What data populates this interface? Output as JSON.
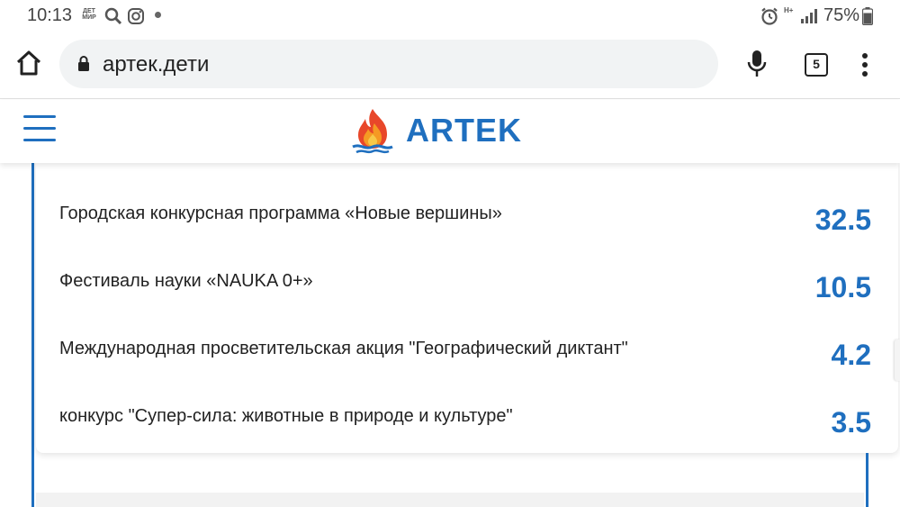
{
  "status_bar": {
    "time": "10:13",
    "mir_label": "ДЕТ МИР",
    "network": "H+",
    "battery": "75%",
    "icons": [
      "search-icon",
      "instagram-icon",
      "alarm-icon",
      "signal-icon",
      "battery-icon"
    ]
  },
  "browser": {
    "url": "артек.дети",
    "tab_count": "5"
  },
  "site": {
    "logo_text": "ARTEK",
    "brand_color": "#1f6fbf"
  },
  "items": [
    {
      "label": "Городская конкурсная программа «Новые вершины»",
      "value": "32.5"
    },
    {
      "label": "Фестиваль науки «NAUKA 0+»",
      "value": "10.5"
    },
    {
      "label": "Международная просветительская акция \"Географический диктант\"",
      "value": "4.2"
    },
    {
      "label": "конкурс \"Супер-сила: животные в природе и культуре\"",
      "value": "3.5"
    }
  ]
}
